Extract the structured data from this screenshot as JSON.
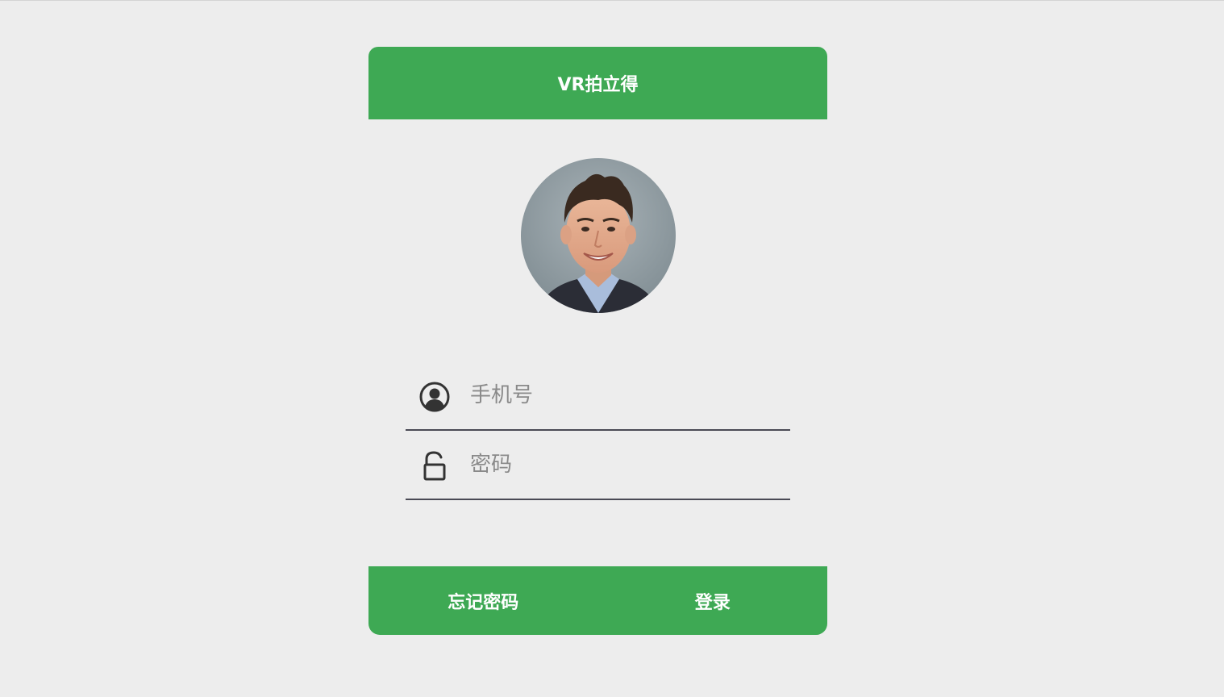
{
  "header": {
    "title": "VR拍立得"
  },
  "form": {
    "phone_placeholder": "手机号",
    "password_placeholder": "密码"
  },
  "footer": {
    "forgot_label": "忘记密码",
    "login_label": "登录"
  },
  "colors": {
    "accent": "#3ea954",
    "background": "#ededed",
    "underline": "#4a4a55"
  },
  "icons": {
    "phone": "user-circle-icon",
    "password": "unlock-icon"
  }
}
